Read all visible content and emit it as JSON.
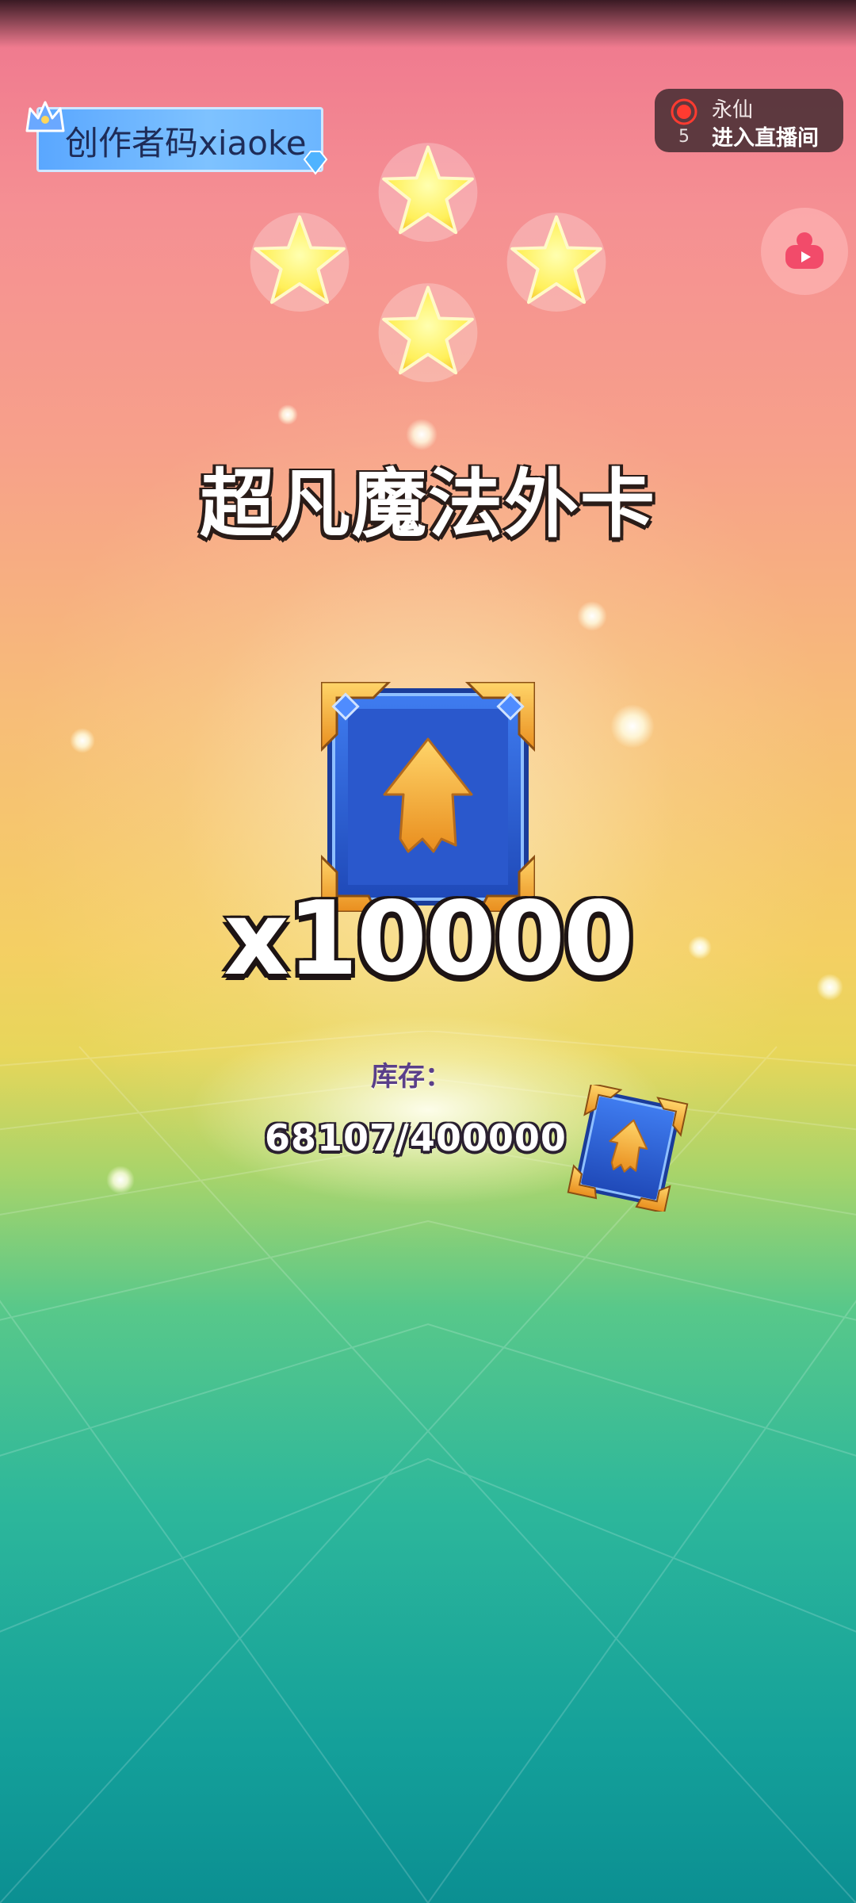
{
  "creator_badge": {
    "label": "创作者码xiaoke",
    "icon": "crown-icon"
  },
  "live": {
    "viewer_count": "5",
    "streamer_name": "永仙",
    "enter_label": "进入直播间",
    "icon": "record-icon",
    "accent": "#ff3b30"
  },
  "side_button": {
    "icon": "video-camera-icon"
  },
  "reward": {
    "stars": 4,
    "title": "超凡魔法外卡",
    "count_text": "x10000",
    "card_icon": "arrow-up-card-icon"
  },
  "stock": {
    "label": "库存：",
    "value": "68107/400000"
  },
  "colors": {
    "card_blue": "#2b63d8",
    "card_gold": "#f5b23a",
    "star_yellow": "#fff05a"
  }
}
